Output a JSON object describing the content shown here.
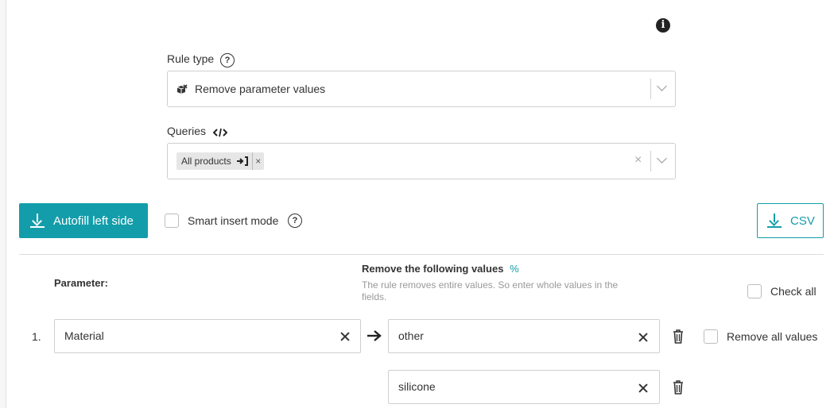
{
  "rule_type": {
    "label": "Rule type",
    "help_icon": "question-circle-icon",
    "selected_value": "Remove parameter values",
    "option_icon": "box-remove-icon"
  },
  "queries": {
    "label": "Queries",
    "code_icon": "code-icon",
    "chip_label": "All products",
    "chip_icon": "sign-in-icon",
    "chip_remove": "×",
    "clear_icon": "×"
  },
  "info_icon": "info-icon",
  "toolbar": {
    "autofill_label": "Autofill left side",
    "smart_insert_label": "Smart insert mode",
    "csv_label": "CSV"
  },
  "table": {
    "parameter_header": "Parameter:",
    "values_header": "Remove the following values",
    "values_header_badge": "%",
    "values_hint": "The rule removes entire values. So enter whole values in the fields.",
    "check_all_label": "Check all",
    "rows": [
      {
        "number": "1.",
        "parameter": "Material",
        "values": [
          "other",
          "silicone"
        ],
        "remove_all_label": "Remove all values"
      }
    ]
  },
  "colors": {
    "accent": "#139daa"
  }
}
